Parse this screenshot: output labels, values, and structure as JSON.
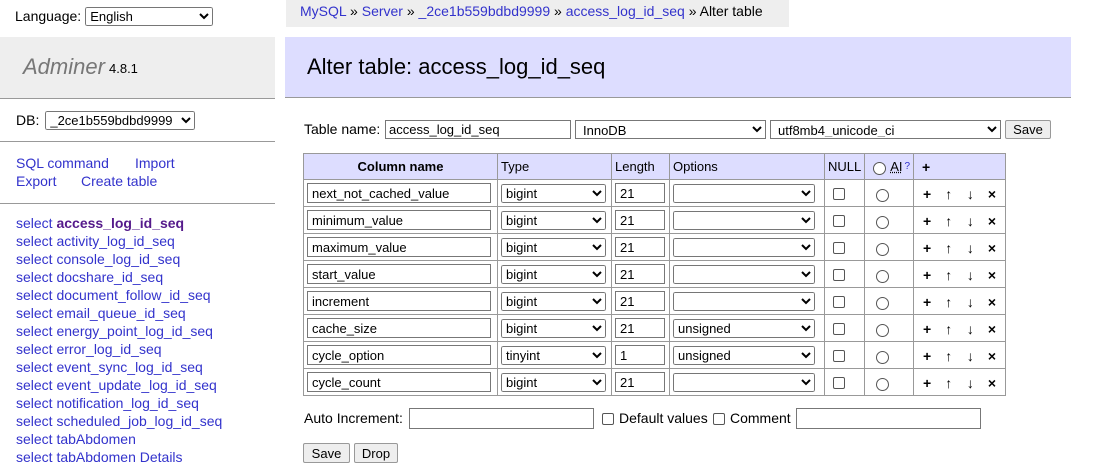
{
  "language": {
    "label": "Language:",
    "value": "English"
  },
  "app": {
    "name": "Adminer",
    "version": "4.8.1"
  },
  "db": {
    "label": "DB:",
    "value": "_2ce1b559bdbd9999"
  },
  "links": {
    "sql_command": "SQL command",
    "import": "Import",
    "export": "Export",
    "create_table": "Create table"
  },
  "tables": [
    {
      "select": "select",
      "name": "access_log_id_seq",
      "current": true
    },
    {
      "select": "select",
      "name": "activity_log_id_seq"
    },
    {
      "select": "select",
      "name": "console_log_id_seq"
    },
    {
      "select": "select",
      "name": "docshare_id_seq"
    },
    {
      "select": "select",
      "name": "document_follow_id_seq"
    },
    {
      "select": "select",
      "name": "email_queue_id_seq"
    },
    {
      "select": "select",
      "name": "energy_point_log_id_seq"
    },
    {
      "select": "select",
      "name": "error_log_id_seq"
    },
    {
      "select": "select",
      "name": "event_sync_log_id_seq"
    },
    {
      "select": "select",
      "name": "event_update_log_id_seq"
    },
    {
      "select": "select",
      "name": "notification_log_id_seq"
    },
    {
      "select": "select",
      "name": "scheduled_job_log_id_seq"
    },
    {
      "select": "select",
      "name": "tabAbdomen"
    },
    {
      "select": "select",
      "name": "tabAbdomen Details"
    }
  ],
  "breadcrumb": {
    "mysql": "MySQL",
    "server": "Server",
    "db": "_2ce1b559bdbd9999",
    "table": "access_log_id_seq",
    "sep": "»",
    "current": "Alter table"
  },
  "heading": "Alter table: access_log_id_seq",
  "table_form": {
    "label": "Table name:",
    "name": "access_log_id_seq",
    "engine": "InnoDB",
    "collation": "utf8mb4_unicode_ci",
    "save": "Save"
  },
  "columns_header": {
    "name": "Column name",
    "type": "Type",
    "length": "Length",
    "options": "Options",
    "null": "NULL",
    "ai": "AI",
    "ai_help": "?",
    "add": "+"
  },
  "columns": [
    {
      "name": "next_not_cached_value",
      "type": "bigint",
      "length": "21",
      "options": ""
    },
    {
      "name": "minimum_value",
      "type": "bigint",
      "length": "21",
      "options": ""
    },
    {
      "name": "maximum_value",
      "type": "bigint",
      "length": "21",
      "options": ""
    },
    {
      "name": "start_value",
      "type": "bigint",
      "length": "21",
      "options": ""
    },
    {
      "name": "increment",
      "type": "bigint",
      "length": "21",
      "options": ""
    },
    {
      "name": "cache_size",
      "type": "bigint",
      "length": "21",
      "options": "unsigned"
    },
    {
      "name": "cycle_option",
      "type": "tinyint",
      "length": "1",
      "options": "unsigned"
    },
    {
      "name": "cycle_count",
      "type": "bigint",
      "length": "21",
      "options": ""
    }
  ],
  "row_actions": {
    "add": "+",
    "up": "↑",
    "down": "↓",
    "remove": "×"
  },
  "bottom": {
    "auto_increment_label": "Auto Increment:",
    "auto_increment_value": "",
    "default_values": "Default values",
    "comment": "Comment",
    "comment_value": "",
    "save": "Save",
    "drop": "Drop"
  }
}
